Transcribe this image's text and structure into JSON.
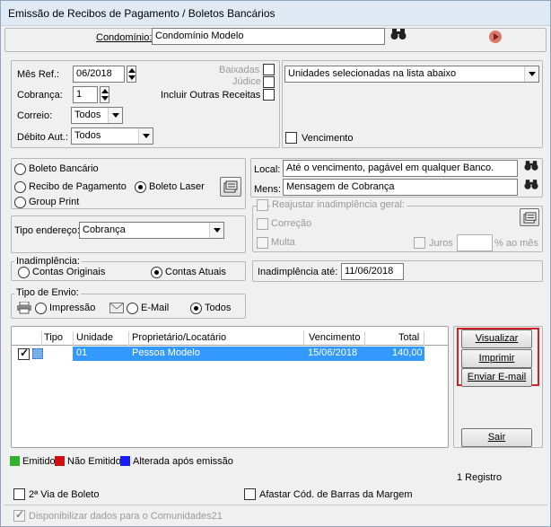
{
  "window": {
    "title": "Emissão de Recibos de Pagamento / Boletos Bancários"
  },
  "condominio": {
    "label": "Condomínio:",
    "value": "Condomínio Modelo"
  },
  "filters": {
    "mes_ref_label": "Mês Ref.:",
    "mes_ref_value": "06/2018",
    "cobranca_label": "Cobrança:",
    "cobranca_value": "1",
    "correio_label": "Correio:",
    "correio_value": "Todos",
    "debito_label": "Débito Aut.:",
    "debito_value": "Todos",
    "baixadas_label": "Baixadas",
    "judice_label": "Júdice",
    "outras_receitas_label": "Incluir Outras Receitas"
  },
  "unidades": {
    "select_value": "Unidades selecionadas na lista abaixo",
    "vencimento_label": "Vencimento"
  },
  "doc_type": {
    "boleto_bancario": "Boleto Bancário",
    "recibo_pagamento": "Recibo de Pagamento",
    "boleto_laser": "Boleto Laser",
    "group_print": "Group Print"
  },
  "local": {
    "label": "Local:",
    "value": "Até o vencimento, pagável em qualquer Banco."
  },
  "mensagem": {
    "label": "Mens:",
    "value": "Mensagem de Cobrança"
  },
  "endereco": {
    "label": "Tipo endereço:",
    "value": "Cobrança"
  },
  "reajuste": {
    "title": "Reajustar inadimplência geral:",
    "correcao": "Correção",
    "multa": "Multa",
    "juros": "Juros",
    "juros_unit": "% ao mês"
  },
  "inadimplencia": {
    "title": "Inadimplência:",
    "originais": "Contas Originais",
    "atuais": "Contas Atuais",
    "ate_label": "Inadimplência até:",
    "ate_value": "11/06/2018"
  },
  "envio": {
    "title": "Tipo de Envio:",
    "impressao": "Impressão",
    "email": "E-Mail",
    "todos": "Todos"
  },
  "grid": {
    "headers": [
      "Tipo",
      "Unidade",
      "Proprietário/Locatário",
      "Vencimento",
      "Total"
    ],
    "rows": [
      {
        "unidade": "01",
        "proprietario": "Pessoa Modelo",
        "vencimento": "15/06/2018",
        "total": "140,00"
      }
    ]
  },
  "actions": {
    "visualizar": "Visualizar",
    "imprimir": "Imprimir",
    "enviar": "Enviar E-mail",
    "sair": "Sair"
  },
  "status_legend": {
    "emitido": "Emitido",
    "nao_emitido": "Não Emitido",
    "alterada": "Alterada após emissão",
    "colors": {
      "emitido": "#2db32d",
      "nao_emitido": "#d01010",
      "alterada": "#1a1aff"
    }
  },
  "registro_count": "1 Registro",
  "options": {
    "segunda_via": "2ª Via de Boleto",
    "afastar": "Afastar Cód. de Barras da Margem",
    "disponibilizar": "Disponibilizar dados para o Comunidades21"
  },
  "icons": {
    "search": "binoculars-icon",
    "play": "play-icon",
    "printer": "printer-icon",
    "envelope": "envelope-icon"
  }
}
